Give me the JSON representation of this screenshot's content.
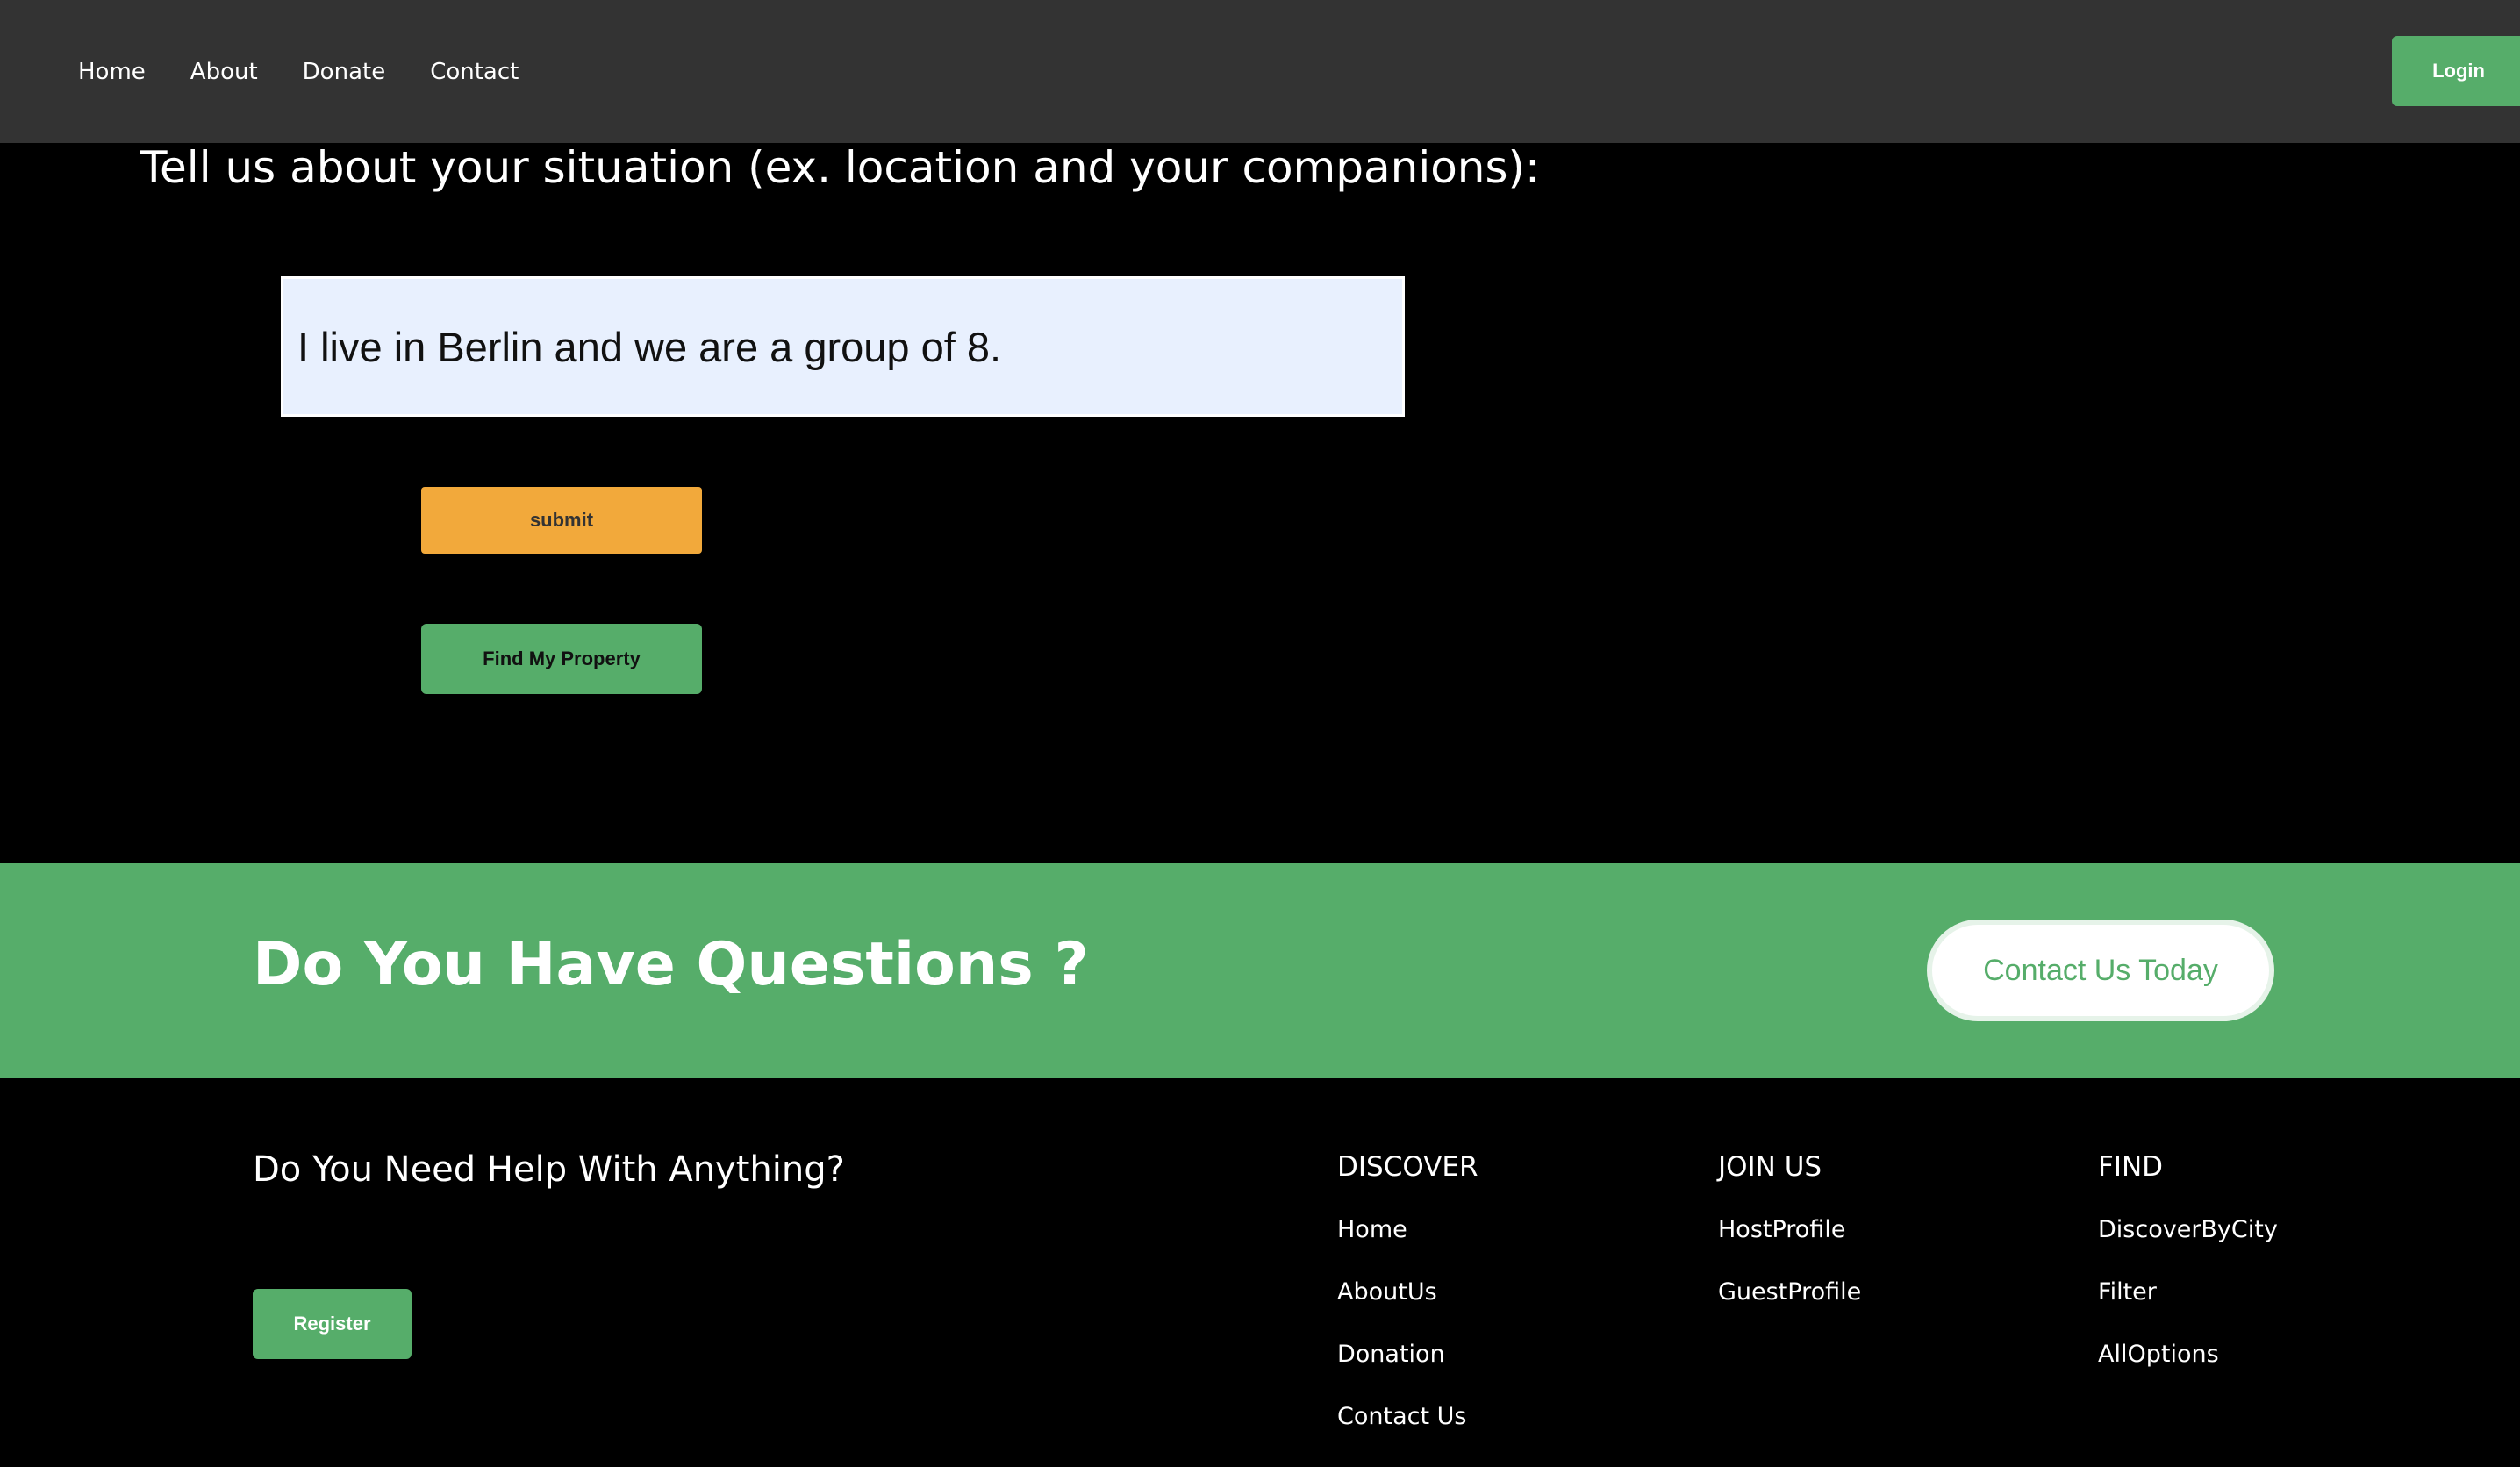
{
  "nav": {
    "links": [
      "Home",
      "About",
      "Donate",
      "Contact"
    ],
    "login_label": "Login"
  },
  "form": {
    "question": "Tell us about your situation (ex. location and your companions):",
    "input_value": "I live in Berlin and we are a group of 8.",
    "submit_label": "submit",
    "find_label": "Find My Property"
  },
  "cta": {
    "title": "Do You Have Questions ?",
    "button_label": "Contact Us Today"
  },
  "footer": {
    "help_title": "Do You Need Help With Anything?",
    "register_label": "Register",
    "columns": [
      {
        "heading": "DISCOVER",
        "links": [
          "Home",
          "AboutUs",
          "Donation",
          "Contact Us"
        ]
      },
      {
        "heading": "JOIN US",
        "links": [
          "HostProfile",
          "GuestProfile"
        ]
      },
      {
        "heading": "FIND",
        "links": [
          "DiscoverByCity",
          "Filter",
          "AllOptions"
        ]
      }
    ]
  },
  "colors": {
    "accent_green": "#56ad6a",
    "submit_orange": "#f2a93b",
    "navbar_bg": "#333333",
    "input_bg": "#e8f0fe"
  }
}
